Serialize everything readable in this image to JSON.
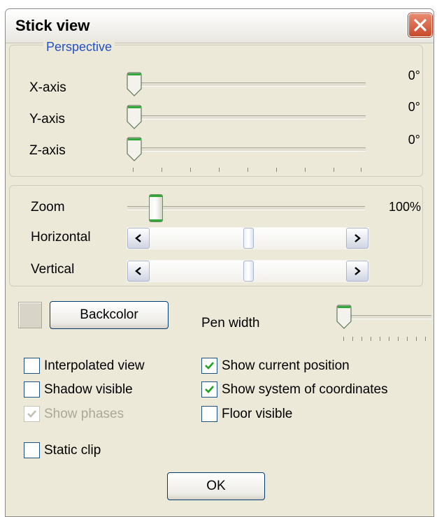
{
  "window": {
    "title": "Stick view"
  },
  "perspective": {
    "legend": "Perspective",
    "sliders": [
      {
        "label": "X-axis",
        "value_text": "0°",
        "level": 0
      },
      {
        "label": "Y-axis",
        "value_text": "0°",
        "level": 0
      },
      {
        "label": "Z-axis",
        "value_text": "0°",
        "level": 0
      }
    ]
  },
  "view": {
    "zoom": {
      "label": "Zoom",
      "value_text": "100%",
      "level": 0.12
    },
    "horizontal": {
      "label": "Horizontal",
      "position": 0.5
    },
    "vertical": {
      "label": "Vertical",
      "position": 0.5
    }
  },
  "backcolor": {
    "button_label": "Backcolor",
    "swatch_color": "#d9d4c8"
  },
  "pen_width": {
    "label": "Pen width",
    "level": 0
  },
  "options": {
    "interpolated": {
      "label": "Interpolated view",
      "checked": false
    },
    "shadow": {
      "label": "Shadow visible",
      "checked": false
    },
    "phases": {
      "label": "Show phases",
      "checked": true,
      "disabled": true
    },
    "static_clip": {
      "label": "Static clip",
      "checked": false
    },
    "current_position": {
      "label": "Show current position",
      "checked": true
    },
    "coordinates": {
      "label": "Show system of coordinates",
      "checked": true
    },
    "floor": {
      "label": "Floor visible",
      "checked": false
    }
  },
  "footer": {
    "ok_label": "OK"
  },
  "colors": {
    "accent_green": "#32a83b",
    "legend_blue": "#2451c5",
    "close_red": "#c74a2a"
  }
}
